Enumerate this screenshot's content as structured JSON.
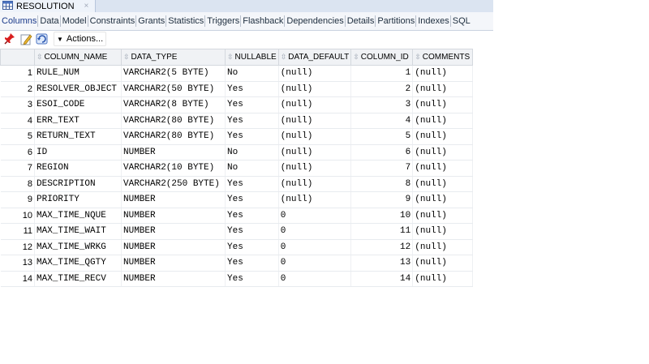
{
  "document_tab": {
    "title": "RESOLUTION",
    "close": "×"
  },
  "subtabs": [
    "Columns",
    "Data",
    "Model",
    "Constraints",
    "Grants",
    "Statistics",
    "Triggers",
    "Flashback",
    "Dependencies",
    "Details",
    "Partitions",
    "Indexes",
    "SQL"
  ],
  "toolbar": {
    "actions_label": "Actions..."
  },
  "columns": [
    "COLUMN_NAME",
    "DATA_TYPE",
    "NULLABLE",
    "DATA_DEFAULT",
    "COLUMN_ID",
    "COMMENTS"
  ],
  "rows": [
    {
      "n": "1",
      "name": "RULE_NUM",
      "type": "VARCHAR2(5 BYTE)",
      "nullable": "No",
      "default": "(null)",
      "id": "1",
      "comments": "(null)"
    },
    {
      "n": "2",
      "name": "RESOLVER_OBJECT",
      "type": "VARCHAR2(50 BYTE)",
      "nullable": "Yes",
      "default": "(null)",
      "id": "2",
      "comments": "(null)"
    },
    {
      "n": "3",
      "name": "ESOI_CODE",
      "type": "VARCHAR2(8 BYTE)",
      "nullable": "Yes",
      "default": "(null)",
      "id": "3",
      "comments": "(null)"
    },
    {
      "n": "4",
      "name": "ERR_TEXT",
      "type": "VARCHAR2(80 BYTE)",
      "nullable": "Yes",
      "default": "(null)",
      "id": "4",
      "comments": "(null)"
    },
    {
      "n": "5",
      "name": "RETURN_TEXT",
      "type": "VARCHAR2(80 BYTE)",
      "nullable": "Yes",
      "default": "(null)",
      "id": "5",
      "comments": "(null)"
    },
    {
      "n": "6",
      "name": "ID",
      "type": "NUMBER",
      "nullable": "No",
      "default": "(null)",
      "id": "6",
      "comments": "(null)"
    },
    {
      "n": "7",
      "name": "REGION",
      "type": "VARCHAR2(10 BYTE)",
      "nullable": "No",
      "default": "(null)",
      "id": "7",
      "comments": "(null)"
    },
    {
      "n": "8",
      "name": "DESCRIPTION",
      "type": "VARCHAR2(250 BYTE)",
      "nullable": "Yes",
      "default": "(null)",
      "id": "8",
      "comments": "(null)"
    },
    {
      "n": "9",
      "name": "PRIORITY",
      "type": "NUMBER",
      "nullable": "Yes",
      "default": "(null)",
      "id": "9",
      "comments": "(null)"
    },
    {
      "n": "10",
      "name": "MAX_TIME_NQUE",
      "type": "NUMBER",
      "nullable": "Yes",
      "default": "0",
      "id": "10",
      "comments": "(null)"
    },
    {
      "n": "11",
      "name": "MAX_TIME_WAIT",
      "type": "NUMBER",
      "nullable": "Yes",
      "default": "0",
      "id": "11",
      "comments": "(null)"
    },
    {
      "n": "12",
      "name": "MAX_TIME_WRKG",
      "type": "NUMBER",
      "nullable": "Yes",
      "default": "0",
      "id": "12",
      "comments": "(null)"
    },
    {
      "n": "13",
      "name": "MAX_TIME_QGTY",
      "type": "NUMBER",
      "nullable": "Yes",
      "default": "0",
      "id": "13",
      "comments": "(null)"
    },
    {
      "n": "14",
      "name": "MAX_TIME_RECV",
      "type": "NUMBER",
      "nullable": "Yes",
      "default": "0",
      "id": "14",
      "comments": "(null)"
    }
  ],
  "icons": [
    "table-icon",
    "pin-icon",
    "edit-icon",
    "refresh-icon",
    "sort-icon"
  ],
  "colors": {
    "tab_strip": "#dbe4f1",
    "header_bg": "#f0f2f5",
    "grid_line": "#e8ebef"
  }
}
